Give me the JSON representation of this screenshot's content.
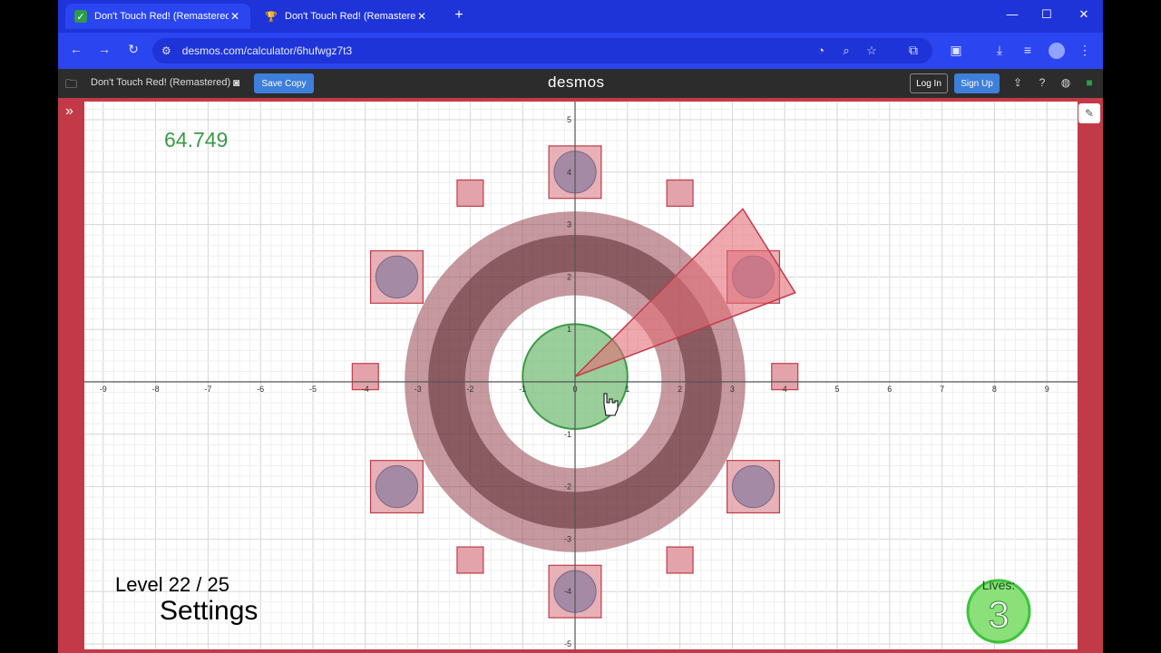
{
  "browser": {
    "tabs": [
      {
        "title": "Don't Touch Red! (Remastered)",
        "active": true,
        "favicon": "desmos-favicon"
      },
      {
        "title": "Don't Touch Red! (Remastered)",
        "active": false,
        "favicon": "trophy-favicon"
      }
    ],
    "url": "desmos.com/calculator/6hufwgz7t3"
  },
  "desmos": {
    "graph_title": "Don't Touch Red! (Remastered)",
    "save_copy": "Save Copy",
    "logo": "desmos",
    "login": "Log In",
    "signup": "Sign Up"
  },
  "game": {
    "timer": "64.749",
    "level": "Level 22 / 25",
    "settings": "Settings",
    "lives_label": "Lives:",
    "lives": "3"
  },
  "axes": {
    "x_ticks": [
      "-9",
      "-8",
      "-7",
      "-6",
      "-5",
      "-4",
      "-3",
      "-2",
      "-1",
      "0",
      "1",
      "2",
      "3",
      "4",
      "5",
      "6",
      "7",
      "8",
      "9"
    ],
    "y_ticks": [
      "5",
      "4",
      "3",
      "2",
      "1",
      "-1",
      "-2",
      "-3",
      "-4",
      "-5"
    ]
  },
  "colors": {
    "red": "#c23a47",
    "green": "#3a9a48",
    "brand_blue": "#2b45f0"
  }
}
